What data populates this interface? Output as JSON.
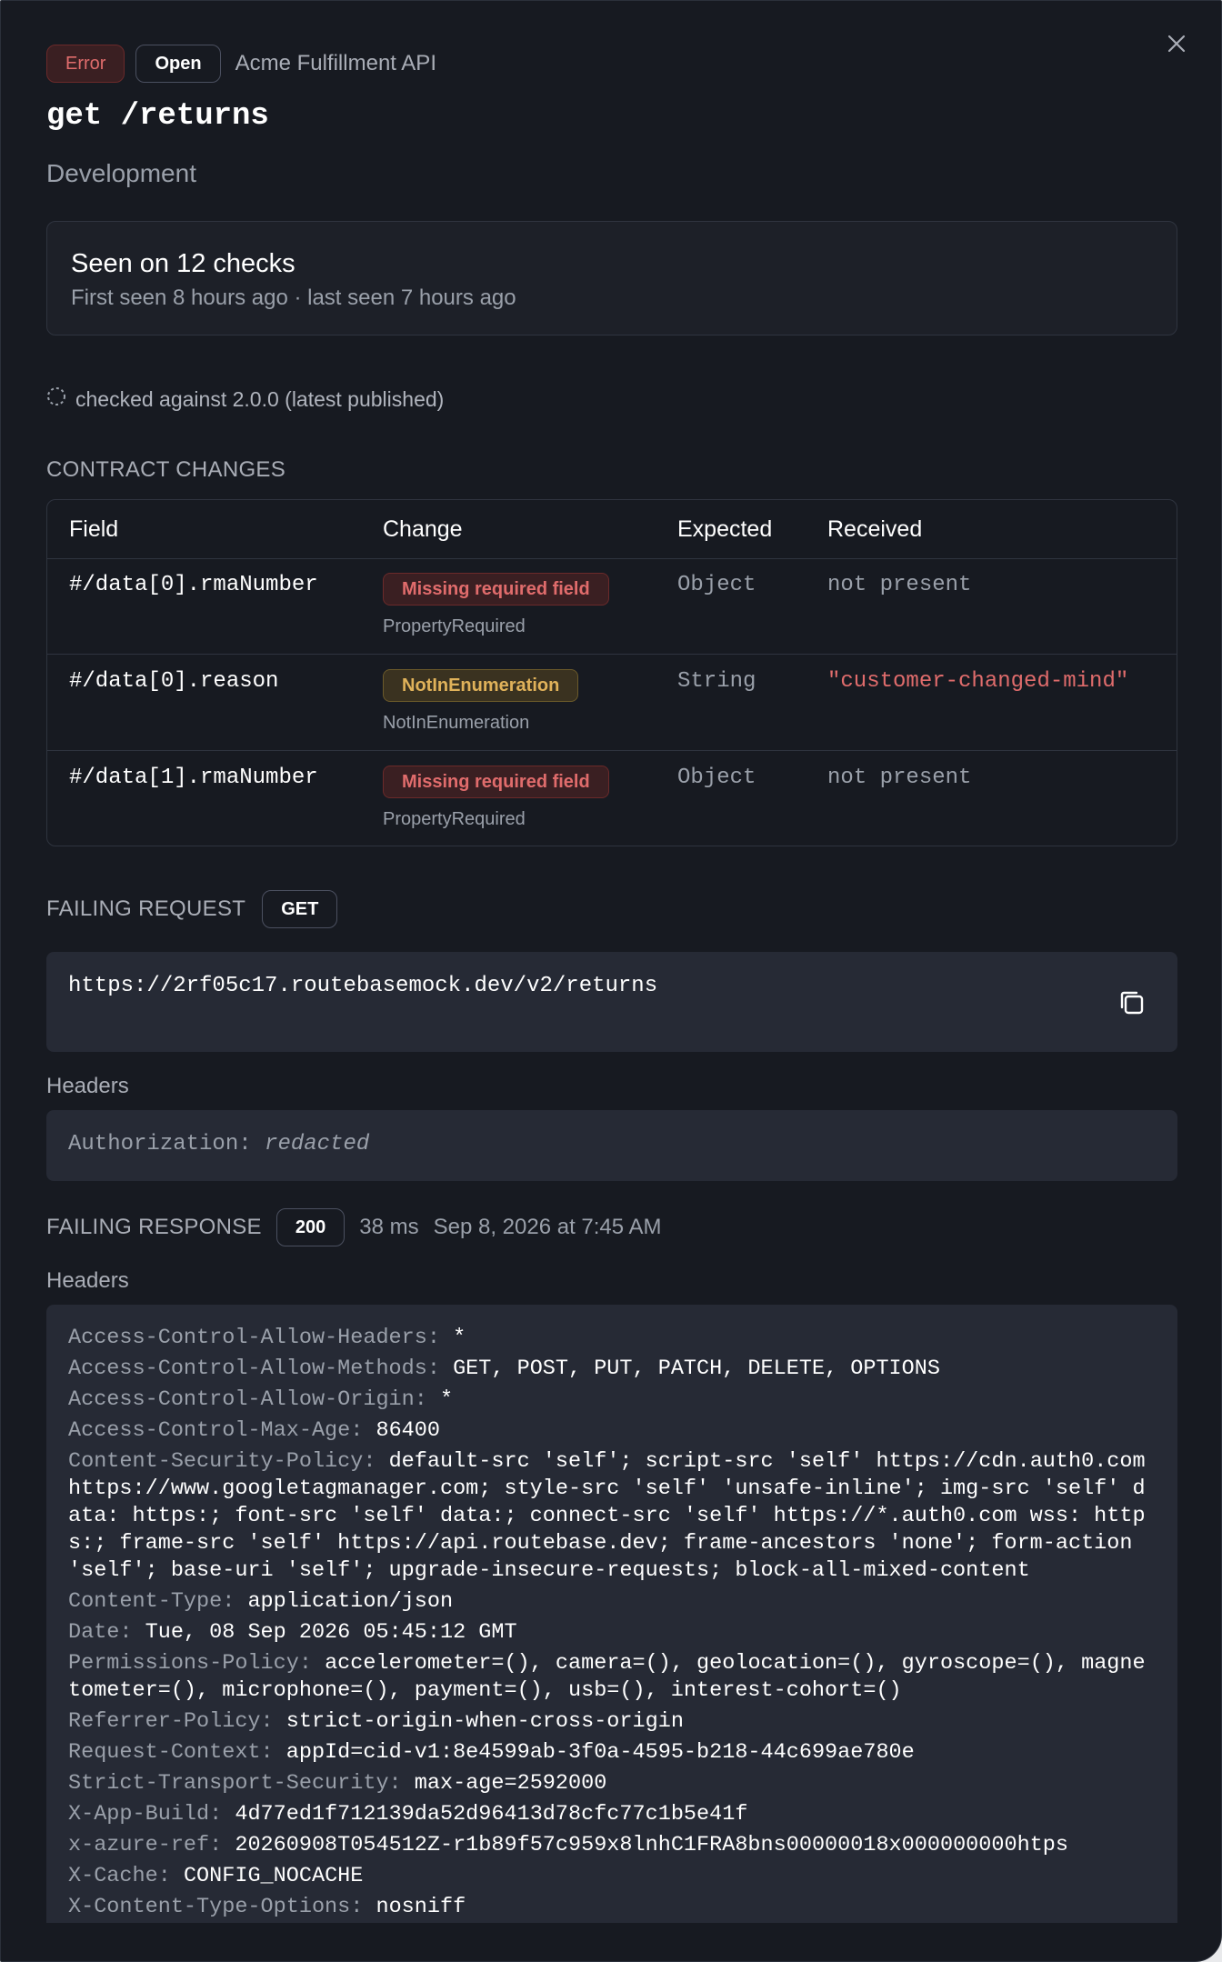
{
  "header": {
    "error_badge": "Error",
    "open_badge": "Open",
    "project_name": "Acme Fulfillment API",
    "endpoint": "get /returns",
    "environment": "Development"
  },
  "seen": {
    "title": "Seen on 12 checks",
    "subtitle": "First seen 8 hours ago · last seen 7 hours ago"
  },
  "checked_against": "checked against 2.0.0 (latest published)",
  "contract_changes": {
    "label": "CONTRACT CHANGES",
    "columns": [
      "Field",
      "Change",
      "Expected",
      "Received"
    ],
    "rows": [
      {
        "field": "#/data[0].rmaNumber",
        "pill": "Missing required field",
        "pill_color": "red",
        "sub": "PropertyRequired",
        "expected": "Object",
        "received": "not present",
        "received_color": "grey"
      },
      {
        "field": "#/data[0].reason",
        "pill": "NotInEnumeration",
        "pill_color": "amber",
        "sub": "NotInEnumeration",
        "expected": "String",
        "received": "\"customer-changed-mind\"",
        "received_color": "red"
      },
      {
        "field": "#/data[1].rmaNumber",
        "pill": "Missing required field",
        "pill_color": "red",
        "sub": "PropertyRequired",
        "expected": "Object",
        "received": "not present",
        "received_color": "grey"
      }
    ]
  },
  "failing_request": {
    "label": "FAILING REQUEST",
    "method": "GET",
    "url": "https://2rf05c17.routebasemock.dev/v2/returns",
    "headers_label": "Headers",
    "auth_key": "Authorization:",
    "auth_value": "redacted"
  },
  "failing_response": {
    "label": "FAILING RESPONSE",
    "status": "200",
    "duration": "38 ms",
    "timestamp": "Sep 8, 2026 at 7:45 AM",
    "headers_label": "Headers",
    "headers": [
      {
        "k": "Access-Control-Allow-Headers:",
        "v": "*"
      },
      {
        "k": "Access-Control-Allow-Methods:",
        "v": "GET, POST, PUT, PATCH, DELETE, OPTIONS"
      },
      {
        "k": "Access-Control-Allow-Origin:",
        "v": "*"
      },
      {
        "k": "Access-Control-Max-Age:",
        "v": "86400"
      },
      {
        "k": "Content-Security-Policy:",
        "v": "default-src 'self'; script-src 'self' https://cdn.auth0.com https://www.googletagmanager.com; style-src 'self' 'unsafe-inline'; img-src 'self' data: https:; font-src 'self' data:; connect-src 'self' https://*.auth0.com wss: https:; frame-src 'self' https://api.routebase.dev; frame-ancestors 'none'; form-action 'self'; base-uri 'self'; upgrade-insecure-requests; block-all-mixed-content"
      },
      {
        "k": "Content-Type:",
        "v": "application/json"
      },
      {
        "k": "Date:",
        "v": "Tue, 08 Sep 2026 05:45:12 GMT"
      },
      {
        "k": "Permissions-Policy:",
        "v": "accelerometer=(), camera=(), geolocation=(), gyroscope=(), magnetometer=(), microphone=(), payment=(), usb=(), interest-cohort=()"
      },
      {
        "k": "Referrer-Policy:",
        "v": "strict-origin-when-cross-origin"
      },
      {
        "k": "Request-Context:",
        "v": "appId=cid-v1:8e4599ab-3f0a-4595-b218-44c699ae780e"
      },
      {
        "k": "Strict-Transport-Security:",
        "v": "max-age=2592000"
      },
      {
        "k": "X-App-Build:",
        "v": "4d77ed1f712139da52d96413d78cfc77c1b5e41f"
      },
      {
        "k": "x-azure-ref:",
        "v": "20260908T054512Z-r1b89f57c959x8lnhC1FRA8bns00000018x000000000htps"
      },
      {
        "k": "X-Cache:",
        "v": "CONFIG_NOCACHE"
      },
      {
        "k": "X-Content-Type-Options:",
        "v": "nosniff"
      }
    ]
  },
  "icons": {
    "close": "close-icon",
    "copy": "copy-icon",
    "spinner": "loading-circle-icon"
  }
}
